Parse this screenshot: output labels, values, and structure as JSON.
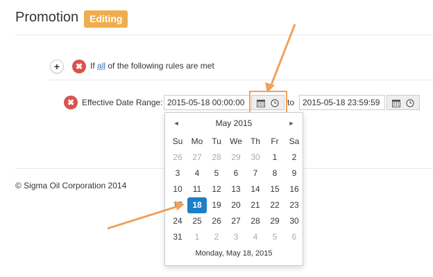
{
  "header": {
    "title": "Promotion",
    "status": "Editing"
  },
  "rules": {
    "add_label": "+",
    "delete_label": "✖",
    "prefix": "If",
    "quantifier": "all",
    "suffix": "of the following rules are met"
  },
  "date_range": {
    "label": "Effective Date Range:",
    "start_value": "2015-05-18 00:00:00",
    "connector": "to",
    "end_value": "2015-05-18 23:59:59"
  },
  "footer": {
    "copyright": "© Sigma Oil Corporation 2014"
  },
  "datepicker": {
    "prev": "◄",
    "next": "►",
    "month_label": "May 2015",
    "weekdays": [
      "Su",
      "Mo",
      "Tu",
      "We",
      "Th",
      "Fr",
      "Sa"
    ],
    "weeks": [
      [
        "26",
        "27",
        "28",
        "29",
        "30",
        "1",
        "2"
      ],
      [
        "3",
        "4",
        "5",
        "6",
        "7",
        "8",
        "9"
      ],
      [
        "10",
        "11",
        "12",
        "13",
        "14",
        "15",
        "16"
      ],
      [
        "17",
        "18",
        "19",
        "20",
        "21",
        "22",
        "23"
      ],
      [
        "24",
        "25",
        "26",
        "27",
        "28",
        "29",
        "30"
      ],
      [
        "31",
        "1",
        "2",
        "3",
        "4",
        "5",
        "6"
      ]
    ],
    "selected_day": "18",
    "footer_text": "Monday, May 18, 2015"
  },
  "colors": {
    "accent": "#f0ad4e",
    "selected": "#1e7fc6",
    "danger": "#d9534f",
    "annotation": "#f0a15a"
  },
  "icons": {
    "calendar": "calendar-icon",
    "clock": "clock-icon"
  }
}
